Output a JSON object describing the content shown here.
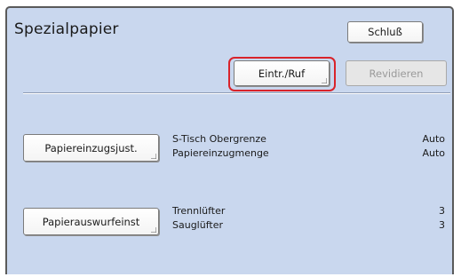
{
  "header": {
    "title": "Spezialpapier",
    "close_label": "Schluß"
  },
  "toolbar": {
    "register_label": "Eintr./Ruf",
    "revise_label": "Revidieren"
  },
  "sections": [
    {
      "button_label": "Papiereinzugsjust.",
      "settings": [
        {
          "name": "S-Tisch Obergrenze",
          "value": "Auto"
        },
        {
          "name": "Papiereinzugmenge",
          "value": "Auto"
        }
      ]
    },
    {
      "button_label": "Papierauswurfeinst",
      "settings": [
        {
          "name": "Trennlüfter",
          "value": "3"
        },
        {
          "name": "Sauglüfter",
          "value": "3"
        }
      ]
    }
  ],
  "colors": {
    "panel_background": "#c9d7ee",
    "highlight": "#d9232a",
    "disabled_text": "#9a9a9a"
  }
}
